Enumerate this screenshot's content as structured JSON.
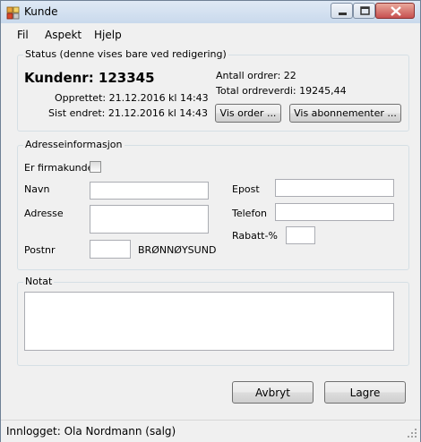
{
  "window": {
    "title": "Kunde"
  },
  "menu": {
    "file": "Fil",
    "aspect": "Aspekt",
    "help": "Hjelp"
  },
  "status": {
    "group_label": "Status (denne vises bare ved redigering)",
    "customer_number": "Kundenr: 123345",
    "created": "Opprettet: 21.12.2016 kl 14:43",
    "last_modified": "Sist endret: 21.12.2016 kl 14:43",
    "order_count": "Antall ordrer: 22",
    "total_order_value": "Total ordreverdi: 19245,44",
    "view_orders_button": "Vis order ...",
    "view_subscriptions_button": "Vis abonnementer ..."
  },
  "address": {
    "group_label": "Adresseinformasjon",
    "company_label": "Er firmakunde",
    "name_label": "Navn",
    "address_label": "Adresse",
    "postcode_label": "Postnr",
    "postcode_value": "",
    "city": "BRØNNØYSUND",
    "email_label": "Epost",
    "phone_label": "Telefon",
    "discount_label": "Rabatt-%"
  },
  "note": {
    "group_label": "Notat"
  },
  "buttons": {
    "cancel": "Avbryt",
    "save": "Lagre"
  },
  "statusbar": {
    "logged_in": "Innlogget: Ola Nordmann (salg)"
  }
}
